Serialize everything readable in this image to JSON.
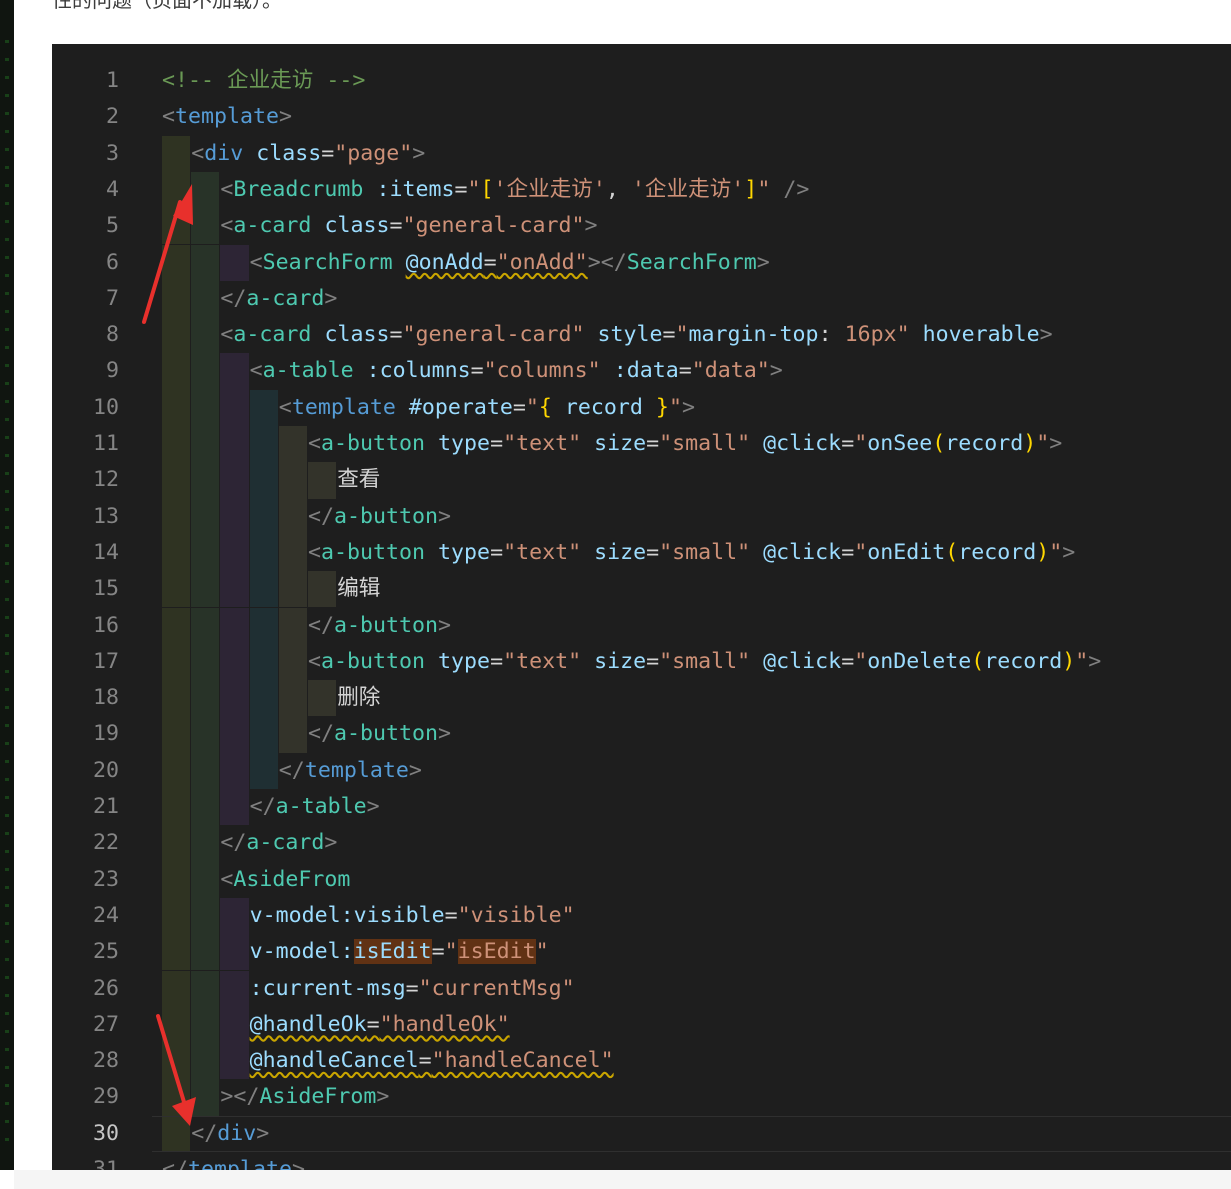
{
  "caption": "性的问题（页面不加载）。",
  "colors": {
    "background": "#1e1e1e",
    "comment": "#6a9955",
    "punctuation": "#808080",
    "tag": "#569cd6",
    "component": "#4ec9b0",
    "attribute": "#9cdcfe",
    "string": "#ce9178",
    "text": "#d4d4d4",
    "arrow": "#e8302c"
  },
  "annotations": [
    {
      "icon": "red-arrow-icon",
      "description": "arrow pointing up"
    },
    {
      "icon": "red-arrow-icon",
      "description": "arrow pointing down"
    }
  ],
  "active_line": 30,
  "lines": [
    {
      "number": 1,
      "indent": 0,
      "tokens": [
        {
          "t": "<!-- 企业走访 -->",
          "c": "cmt"
        }
      ]
    },
    {
      "number": 2,
      "indent": 0,
      "tokens": [
        {
          "t": "<",
          "c": "pun"
        },
        {
          "t": "template",
          "c": "tag"
        },
        {
          "t": ">",
          "c": "pun"
        }
      ]
    },
    {
      "number": 3,
      "indent": 1,
      "tokens": [
        {
          "t": "<",
          "c": "pun"
        },
        {
          "t": "div",
          "c": "tag"
        },
        {
          "t": " ",
          "c": "txt"
        },
        {
          "t": "class",
          "c": "atr"
        },
        {
          "t": "=",
          "c": "txt"
        },
        {
          "t": "\"page\"",
          "c": "str"
        },
        {
          "t": ">",
          "c": "pun"
        }
      ]
    },
    {
      "number": 4,
      "indent": 2,
      "tokens": [
        {
          "t": "<",
          "c": "pun"
        },
        {
          "t": "Breadcrumb",
          "c": "cmp"
        },
        {
          "t": " ",
          "c": "txt"
        },
        {
          "t": ":items",
          "c": "atr"
        },
        {
          "t": "=",
          "c": "txt"
        },
        {
          "t": "\"",
          "c": "str"
        },
        {
          "t": "[",
          "c": "yel"
        },
        {
          "t": "'企业走访'",
          "c": "str"
        },
        {
          "t": ", ",
          "c": "txt"
        },
        {
          "t": "'企业走访'",
          "c": "str"
        },
        {
          "t": "]",
          "c": "yel"
        },
        {
          "t": "\"",
          "c": "str"
        },
        {
          "t": " />",
          "c": "pun"
        }
      ]
    },
    {
      "number": 5,
      "indent": 2,
      "tokens": [
        {
          "t": "<",
          "c": "pun"
        },
        {
          "t": "a-card",
          "c": "cmp"
        },
        {
          "t": " ",
          "c": "txt"
        },
        {
          "t": "class",
          "c": "atr"
        },
        {
          "t": "=",
          "c": "txt"
        },
        {
          "t": "\"general-card\"",
          "c": "str"
        },
        {
          "t": ">",
          "c": "pun"
        }
      ]
    },
    {
      "number": 6,
      "indent": 3,
      "tokens": [
        {
          "t": "<",
          "c": "pun"
        },
        {
          "t": "SearchForm",
          "c": "cmp"
        },
        {
          "t": " ",
          "c": "txt"
        },
        {
          "t": "@onAdd",
          "c": "atr",
          "s": 1
        },
        {
          "t": "=",
          "c": "txt",
          "s": 1
        },
        {
          "t": "\"onAdd\"",
          "c": "str",
          "s": 1
        },
        {
          "t": "></",
          "c": "pun"
        },
        {
          "t": "SearchForm",
          "c": "cmp"
        },
        {
          "t": ">",
          "c": "pun"
        }
      ]
    },
    {
      "number": 7,
      "indent": 2,
      "tokens": [
        {
          "t": "</",
          "c": "pun"
        },
        {
          "t": "a-card",
          "c": "cmp"
        },
        {
          "t": ">",
          "c": "pun"
        }
      ]
    },
    {
      "number": 8,
      "indent": 2,
      "tokens": [
        {
          "t": "<",
          "c": "pun"
        },
        {
          "t": "a-card",
          "c": "cmp"
        },
        {
          "t": " ",
          "c": "txt"
        },
        {
          "t": "class",
          "c": "atr"
        },
        {
          "t": "=",
          "c": "txt"
        },
        {
          "t": "\"general-card\"",
          "c": "str"
        },
        {
          "t": " ",
          "c": "txt"
        },
        {
          "t": "style",
          "c": "atr"
        },
        {
          "t": "=",
          "c": "txt"
        },
        {
          "t": "\"",
          "c": "str"
        },
        {
          "t": "margin-top",
          "c": "atr"
        },
        {
          "t": ": ",
          "c": "txt"
        },
        {
          "t": "16px",
          "c": "str"
        },
        {
          "t": "\"",
          "c": "str"
        },
        {
          "t": " ",
          "c": "txt"
        },
        {
          "t": "hoverable",
          "c": "atr"
        },
        {
          "t": ">",
          "c": "pun"
        }
      ]
    },
    {
      "number": 9,
      "indent": 3,
      "tokens": [
        {
          "t": "<",
          "c": "pun"
        },
        {
          "t": "a-table",
          "c": "cmp"
        },
        {
          "t": " ",
          "c": "txt"
        },
        {
          "t": ":columns",
          "c": "atr"
        },
        {
          "t": "=",
          "c": "txt"
        },
        {
          "t": "\"columns\"",
          "c": "str"
        },
        {
          "t": " ",
          "c": "txt"
        },
        {
          "t": ":data",
          "c": "atr"
        },
        {
          "t": "=",
          "c": "txt"
        },
        {
          "t": "\"data\"",
          "c": "str"
        },
        {
          "t": ">",
          "c": "pun"
        }
      ]
    },
    {
      "number": 10,
      "indent": 4,
      "tokens": [
        {
          "t": "<",
          "c": "pun"
        },
        {
          "t": "template",
          "c": "tag"
        },
        {
          "t": " ",
          "c": "txt"
        },
        {
          "t": "#operate",
          "c": "atr"
        },
        {
          "t": "=",
          "c": "txt"
        },
        {
          "t": "\"",
          "c": "str"
        },
        {
          "t": "{",
          "c": "yel"
        },
        {
          "t": " record ",
          "c": "atr"
        },
        {
          "t": "}",
          "c": "yel"
        },
        {
          "t": "\"",
          "c": "str"
        },
        {
          "t": ">",
          "c": "pun"
        }
      ]
    },
    {
      "number": 11,
      "indent": 5,
      "tokens": [
        {
          "t": "<",
          "c": "pun"
        },
        {
          "t": "a-button",
          "c": "cmp"
        },
        {
          "t": " ",
          "c": "txt"
        },
        {
          "t": "type",
          "c": "atr"
        },
        {
          "t": "=",
          "c": "txt"
        },
        {
          "t": "\"text\"",
          "c": "str"
        },
        {
          "t": " ",
          "c": "txt"
        },
        {
          "t": "size",
          "c": "atr"
        },
        {
          "t": "=",
          "c": "txt"
        },
        {
          "t": "\"small\"",
          "c": "str"
        },
        {
          "t": " ",
          "c": "txt"
        },
        {
          "t": "@click",
          "c": "atr"
        },
        {
          "t": "=",
          "c": "txt"
        },
        {
          "t": "\"",
          "c": "str"
        },
        {
          "t": "onSee",
          "c": "atr"
        },
        {
          "t": "(",
          "c": "yel"
        },
        {
          "t": "record",
          "c": "atr"
        },
        {
          "t": ")",
          "c": "yel"
        },
        {
          "t": "\"",
          "c": "str"
        },
        {
          "t": ">",
          "c": "pun"
        }
      ]
    },
    {
      "number": 12,
      "indent": 6,
      "tokens": [
        {
          "t": "查看",
          "c": "txt"
        }
      ]
    },
    {
      "number": 13,
      "indent": 5,
      "tokens": [
        {
          "t": "</",
          "c": "pun"
        },
        {
          "t": "a-button",
          "c": "cmp"
        },
        {
          "t": ">",
          "c": "pun"
        }
      ]
    },
    {
      "number": 14,
      "indent": 5,
      "tokens": [
        {
          "t": "<",
          "c": "pun"
        },
        {
          "t": "a-button",
          "c": "cmp"
        },
        {
          "t": " ",
          "c": "txt"
        },
        {
          "t": "type",
          "c": "atr"
        },
        {
          "t": "=",
          "c": "txt"
        },
        {
          "t": "\"text\"",
          "c": "str"
        },
        {
          "t": " ",
          "c": "txt"
        },
        {
          "t": "size",
          "c": "atr"
        },
        {
          "t": "=",
          "c": "txt"
        },
        {
          "t": "\"small\"",
          "c": "str"
        },
        {
          "t": " ",
          "c": "txt"
        },
        {
          "t": "@click",
          "c": "atr"
        },
        {
          "t": "=",
          "c": "txt"
        },
        {
          "t": "\"",
          "c": "str"
        },
        {
          "t": "onEdit",
          "c": "atr"
        },
        {
          "t": "(",
          "c": "yel"
        },
        {
          "t": "record",
          "c": "atr"
        },
        {
          "t": ")",
          "c": "yel"
        },
        {
          "t": "\"",
          "c": "str"
        },
        {
          "t": ">",
          "c": "pun"
        }
      ]
    },
    {
      "number": 15,
      "indent": 6,
      "tokens": [
        {
          "t": "编辑",
          "c": "txt"
        }
      ]
    },
    {
      "number": 16,
      "indent": 5,
      "tokens": [
        {
          "t": "</",
          "c": "pun"
        },
        {
          "t": "a-button",
          "c": "cmp"
        },
        {
          "t": ">",
          "c": "pun"
        }
      ]
    },
    {
      "number": 17,
      "indent": 5,
      "tokens": [
        {
          "t": "<",
          "c": "pun"
        },
        {
          "t": "a-button",
          "c": "cmp"
        },
        {
          "t": " ",
          "c": "txt"
        },
        {
          "t": "type",
          "c": "atr"
        },
        {
          "t": "=",
          "c": "txt"
        },
        {
          "t": "\"text\"",
          "c": "str"
        },
        {
          "t": " ",
          "c": "txt"
        },
        {
          "t": "size",
          "c": "atr"
        },
        {
          "t": "=",
          "c": "txt"
        },
        {
          "t": "\"small\"",
          "c": "str"
        },
        {
          "t": " ",
          "c": "txt"
        },
        {
          "t": "@click",
          "c": "atr"
        },
        {
          "t": "=",
          "c": "txt"
        },
        {
          "t": "\"",
          "c": "str"
        },
        {
          "t": "onDelete",
          "c": "atr"
        },
        {
          "t": "(",
          "c": "yel"
        },
        {
          "t": "record",
          "c": "atr"
        },
        {
          "t": ")",
          "c": "yel"
        },
        {
          "t": "\"",
          "c": "str"
        },
        {
          "t": ">",
          "c": "pun"
        }
      ]
    },
    {
      "number": 18,
      "indent": 6,
      "tokens": [
        {
          "t": "删除",
          "c": "txt"
        }
      ]
    },
    {
      "number": 19,
      "indent": 5,
      "tokens": [
        {
          "t": "</",
          "c": "pun"
        },
        {
          "t": "a-button",
          "c": "cmp"
        },
        {
          "t": ">",
          "c": "pun"
        }
      ]
    },
    {
      "number": 20,
      "indent": 4,
      "tokens": [
        {
          "t": "</",
          "c": "pun"
        },
        {
          "t": "template",
          "c": "tag"
        },
        {
          "t": ">",
          "c": "pun"
        }
      ]
    },
    {
      "number": 21,
      "indent": 3,
      "tokens": [
        {
          "t": "</",
          "c": "pun"
        },
        {
          "t": "a-table",
          "c": "cmp"
        },
        {
          "t": ">",
          "c": "pun"
        }
      ]
    },
    {
      "number": 22,
      "indent": 2,
      "tokens": [
        {
          "t": "</",
          "c": "pun"
        },
        {
          "t": "a-card",
          "c": "cmp"
        },
        {
          "t": ">",
          "c": "pun"
        }
      ]
    },
    {
      "number": 23,
      "indent": 2,
      "tokens": [
        {
          "t": "<",
          "c": "pun"
        },
        {
          "t": "AsideFrom",
          "c": "cmp"
        }
      ]
    },
    {
      "number": 24,
      "indent": 3,
      "tokens": [
        {
          "t": "v-model:visible",
          "c": "atr"
        },
        {
          "t": "=",
          "c": "txt"
        },
        {
          "t": "\"visible\"",
          "c": "str"
        }
      ]
    },
    {
      "number": 25,
      "indent": 3,
      "tokens": [
        {
          "t": "v-model:",
          "c": "atr"
        },
        {
          "t": "isEdit",
          "c": "atr",
          "h": 1
        },
        {
          "t": "=",
          "c": "txt"
        },
        {
          "t": "\"",
          "c": "str"
        },
        {
          "t": "isEdit",
          "c": "str",
          "h": 1
        },
        {
          "t": "\"",
          "c": "str"
        }
      ]
    },
    {
      "number": 26,
      "indent": 3,
      "tokens": [
        {
          "t": ":current-msg",
          "c": "atr"
        },
        {
          "t": "=",
          "c": "txt"
        },
        {
          "t": "\"currentMsg\"",
          "c": "str"
        }
      ]
    },
    {
      "number": 27,
      "indent": 3,
      "tokens": [
        {
          "t": "@handleOk",
          "c": "atr",
          "s": 1
        },
        {
          "t": "=",
          "c": "txt",
          "s": 1
        },
        {
          "t": "\"handleOk\"",
          "c": "str",
          "s": 1
        }
      ]
    },
    {
      "number": 28,
      "indent": 3,
      "tokens": [
        {
          "t": "@handleCancel",
          "c": "atr",
          "s": 1
        },
        {
          "t": "=",
          "c": "txt",
          "s": 1
        },
        {
          "t": "\"handleCancel\"",
          "c": "str",
          "s": 1
        }
      ]
    },
    {
      "number": 29,
      "indent": 2,
      "tokens": [
        {
          "t": "></",
          "c": "pun"
        },
        {
          "t": "AsideFrom",
          "c": "cmp"
        },
        {
          "t": ">",
          "c": "pun"
        }
      ]
    },
    {
      "number": 30,
      "indent": 1,
      "tokens": [
        {
          "t": "</",
          "c": "pun"
        },
        {
          "t": "div",
          "c": "tag"
        },
        {
          "t": ">",
          "c": "pun"
        }
      ]
    },
    {
      "number": 31,
      "indent": 0,
      "tokens": [
        {
          "t": "</",
          "c": "pun"
        },
        {
          "t": "template",
          "c": "tag"
        },
        {
          "t": ">",
          "c": "pun"
        }
      ]
    }
  ]
}
